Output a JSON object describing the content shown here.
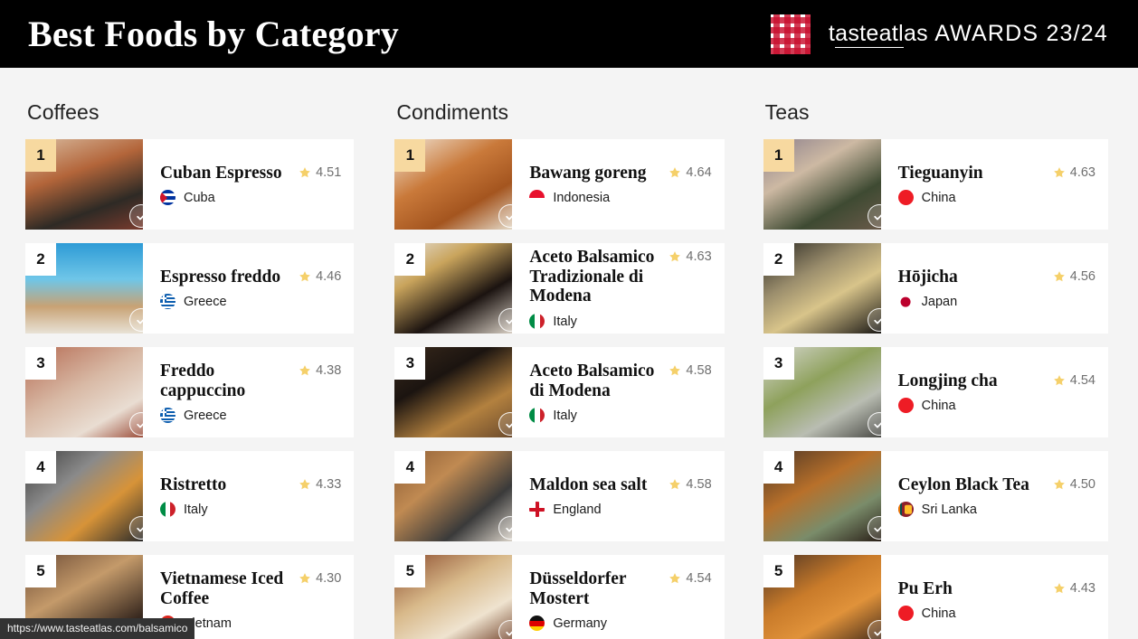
{
  "header": {
    "title": "Best Foods by Category",
    "brand_primary": "taste",
    "brand_primary_underlined": "a",
    "brand_primary_underlined2": "tl",
    "brand_full": "tasteatlas",
    "brand_suffix": "AWARDS 23/24",
    "brand_mark": "gingham-checkered-square",
    "background_color": "#000000",
    "text_color": "#ffffff"
  },
  "theme": {
    "page_background": "#f4f4f4",
    "card_background": "#ffffff",
    "rank_gold": "#f7d9a0",
    "star_color": "#f5d06a",
    "rating_text": "#6f6f6f"
  },
  "status_bar": {
    "url": "https://www.tasteatlas.com/balsamico"
  },
  "columns": [
    {
      "title": "Coffees",
      "items": [
        {
          "rank": "1",
          "name": "Cuban Espresso",
          "rating": "4.51",
          "country": "Cuba",
          "flag": "f-cuba",
          "gold": true,
          "verified": true
        },
        {
          "rank": "2",
          "name": "Espresso freddo",
          "rating": "4.46",
          "country": "Greece",
          "flag": "f-greece",
          "gold": false,
          "verified": true
        },
        {
          "rank": "3",
          "name": "Freddo cappuccino",
          "rating": "4.38",
          "country": "Greece",
          "flag": "f-greece",
          "gold": false,
          "verified": true
        },
        {
          "rank": "4",
          "name": "Ristretto",
          "rating": "4.33",
          "country": "Italy",
          "flag": "f-italy",
          "gold": false,
          "verified": true
        },
        {
          "rank": "5",
          "name": "Vietnamese Iced Coffee",
          "rating": "4.30",
          "country": "Vietnam",
          "flag": "f-vietnam",
          "gold": false,
          "verified": true
        }
      ]
    },
    {
      "title": "Condiments",
      "items": [
        {
          "rank": "1",
          "name": "Bawang goreng",
          "rating": "4.64",
          "country": "Indonesia",
          "flag": "f-indonesia",
          "gold": true,
          "verified": true
        },
        {
          "rank": "2",
          "name": "Aceto Balsamico Tradizionale di Modena",
          "rating": "4.63",
          "country": "Italy",
          "flag": "f-italy",
          "gold": false,
          "verified": true
        },
        {
          "rank": "3",
          "name": "Aceto Balsamico di Modena",
          "rating": "4.58",
          "country": "Italy",
          "flag": "f-italy",
          "gold": false,
          "verified": true
        },
        {
          "rank": "4",
          "name": "Maldon sea salt",
          "rating": "4.58",
          "country": "England",
          "flag": "f-england",
          "gold": false,
          "verified": true
        },
        {
          "rank": "5",
          "name": "Düsseldorfer Mostert",
          "rating": "4.54",
          "country": "Germany",
          "flag": "f-germany",
          "gold": false,
          "verified": true
        }
      ]
    },
    {
      "title": "Teas",
      "items": [
        {
          "rank": "1",
          "name": "Tieguanyin",
          "rating": "4.63",
          "country": "China",
          "flag": "f-china",
          "gold": true,
          "verified": true
        },
        {
          "rank": "2",
          "name": "Hōjicha",
          "rating": "4.56",
          "country": "Japan",
          "flag": "f-japan",
          "gold": false,
          "verified": true
        },
        {
          "rank": "3",
          "name": "Longjing cha",
          "rating": "4.54",
          "country": "China",
          "flag": "f-china",
          "gold": false,
          "verified": true
        },
        {
          "rank": "4",
          "name": "Ceylon Black Tea",
          "rating": "4.50",
          "country": "Sri Lanka",
          "flag": "f-srilanka",
          "gold": false,
          "verified": true
        },
        {
          "rank": "5",
          "name": "Pu Erh",
          "rating": "4.43",
          "country": "China",
          "flag": "f-china",
          "gold": false,
          "verified": true
        }
      ]
    }
  ],
  "thumbnails": {
    "cuban-espresso": "linear-gradient(160deg,#d9bca0 0%,#b3653a 38%,#2e2a25 72%,#7a3b2e 100%)",
    "espresso-freddo": "linear-gradient(180deg,#2e9bd6 0%,#6fc6e8 40%,#c8a274 70%,#e8e2d6 100%)",
    "freddo-cappuccino": "linear-gradient(150deg,#b56a52 0%,#d8b9a5 45%,#e9ddd2 75%,#9c4f3c 100%)",
    "ristretto": "linear-gradient(140deg,#3b3b3b 0%,#8a8a8a 35%,#d79338 65%,#2b2b2b 100%)",
    "vietnamese-iced-coffee": "linear-gradient(150deg,#6b4a35 0%,#c49a6a 40%,#3a2a20 80%,#1d1510 100%)",
    "bawang-goreng": "linear-gradient(150deg,#f1e6d8 0%,#c9793a 40%,#a4551f 70%,#e4d9c7 100%)",
    "aceto-tradizionale": "linear-gradient(150deg,#e6e1dc 0%,#c9a45c 30%,#1b1310 65%,#d8cfc4 100%)",
    "aceto-modena": "linear-gradient(150deg,#3a2a1c 0%,#1b1410 35%,#b3813f 70%,#6b4a2c 100%)",
    "maldon-sea-salt": "linear-gradient(140deg,#8a5a33 0%,#c08a52 35%,#3a3a3a 70%,#d9d2c8 100%)",
    "dusseldorfer-mostert": "linear-gradient(150deg,#8a4a2c 0%,#d8b98a 40%,#efe3cf 70%,#6b3a22 100%)",
    "tieguanyin": "linear-gradient(150deg,#8a7e8c 0%,#cdb9a3 35%,#3e4a32 70%,#6a5a4a 100%)",
    "hojicha": "linear-gradient(150deg,#262420 0%,#9a8d6c 35%,#d8c48a 60%,#1a1815 100%)",
    "longjing-cha": "linear-gradient(150deg,#d9d9d4 0%,#8ea15c 40%,#b9bdb2 70%,#4a4a46 100%)",
    "ceylon-black-tea": "linear-gradient(150deg,#4a3526 0%,#b8702a 40%,#7a8c6a 70%,#2a2018 100%)",
    "pu-erh": "linear-gradient(150deg,#4a3224 0%,#c97b2a 40%,#e0923a 65%,#3a2418 100%)"
  },
  "thumb_keys": [
    [
      "cuban-espresso",
      "espresso-freddo",
      "freddo-cappuccino",
      "ristretto",
      "vietnamese-iced-coffee"
    ],
    [
      "bawang-goreng",
      "aceto-tradizionale",
      "aceto-modena",
      "maldon-sea-salt",
      "dusseldorfer-mostert"
    ],
    [
      "tieguanyin",
      "hojicha",
      "longjing-cha",
      "ceylon-black-tea",
      "pu-erh"
    ]
  ]
}
